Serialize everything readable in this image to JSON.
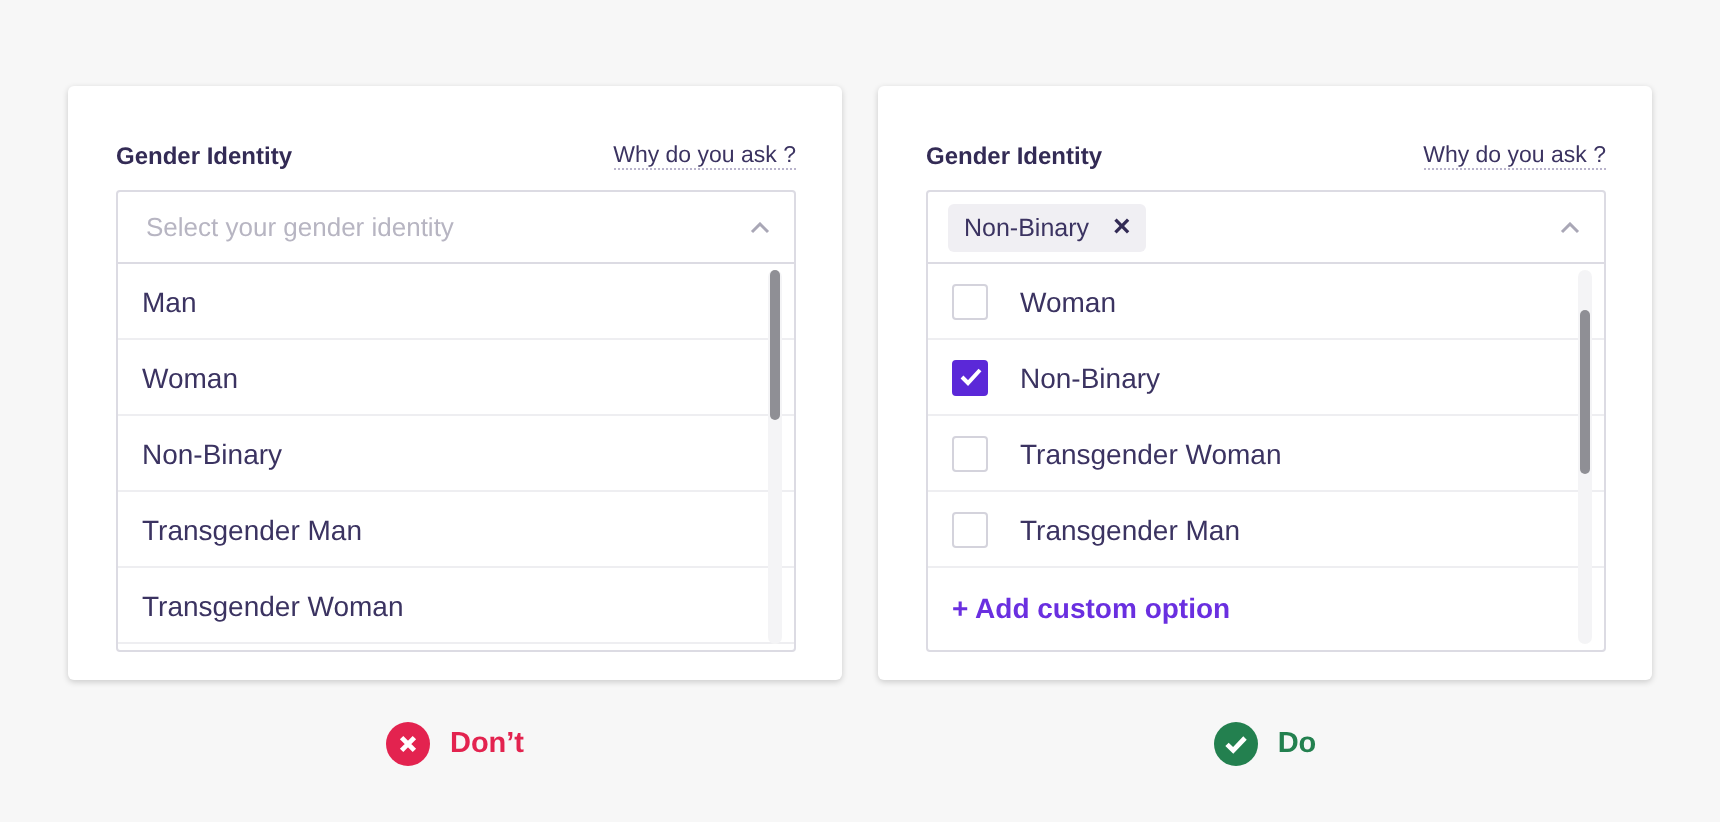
{
  "panels": [
    {
      "field": {
        "label": "Gender Identity",
        "help_link": "Why do you ask ?",
        "placeholder": "Select your gender identity",
        "expanded": true,
        "scrolled": false,
        "options": [
          {
            "kind": "plain",
            "label": "Man"
          },
          {
            "kind": "plain",
            "label": "Woman"
          },
          {
            "kind": "plain",
            "label": "Non-Binary"
          },
          {
            "kind": "plain",
            "label": "Transgender Man"
          },
          {
            "kind": "plain",
            "label": "Transgender Woman"
          }
        ]
      },
      "verdict": {
        "kind": "dont",
        "label": "Don’t",
        "color": "#e3234f"
      }
    },
    {
      "field": {
        "label": "Gender Identity",
        "help_link": "Why do you ask ?",
        "chips": [
          {
            "label": "Non-Binary",
            "remove": "×"
          }
        ],
        "expanded": true,
        "scrolled": true,
        "options": [
          {
            "kind": "checkbox",
            "label": "Woman",
            "checked": false
          },
          {
            "kind": "checkbox",
            "label": "Non-Binary",
            "checked": true
          },
          {
            "kind": "checkbox",
            "label": "Transgender Woman",
            "checked": false
          },
          {
            "kind": "checkbox",
            "label": "Transgender Man",
            "checked": false
          }
        ],
        "action": "+ Add custom option"
      },
      "verdict": {
        "kind": "do",
        "label": "Do",
        "color": "#23804f"
      }
    }
  ]
}
